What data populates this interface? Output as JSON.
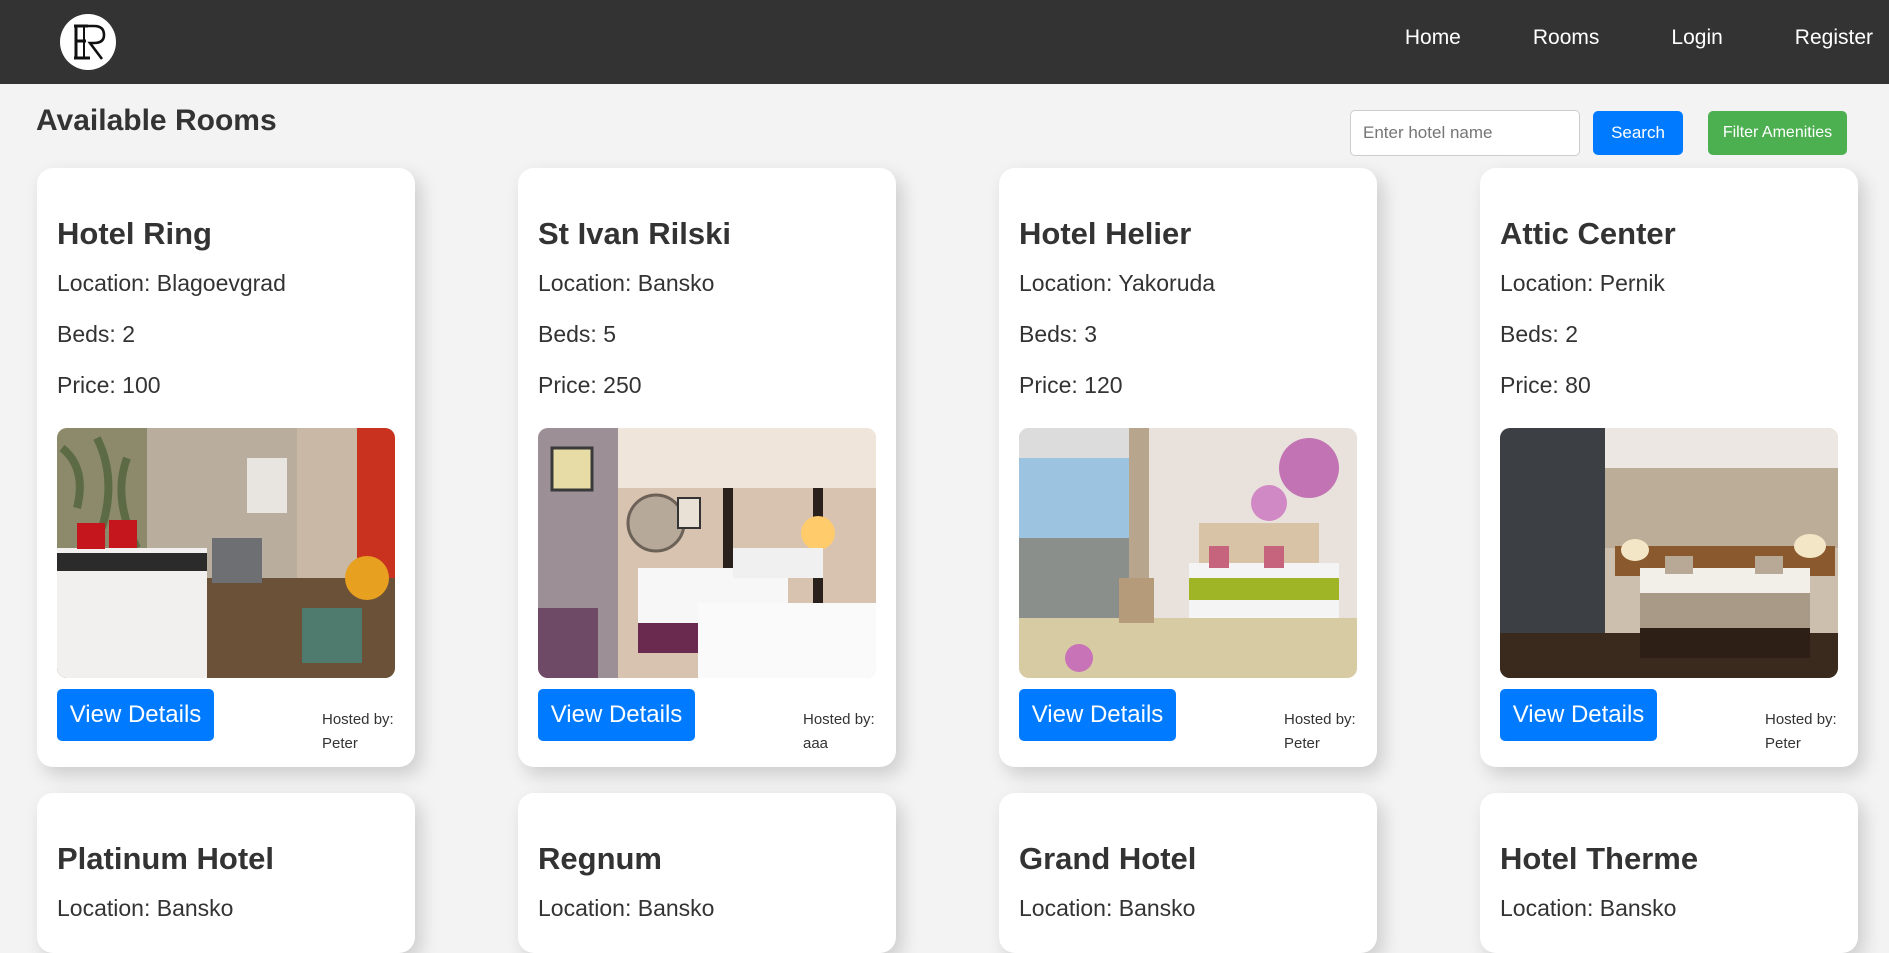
{
  "nav": {
    "logo_icon": "er-monogram-logo",
    "links": [
      "Home",
      "Rooms",
      "Login",
      "Register"
    ]
  },
  "page": {
    "title": "Available Rooms"
  },
  "search": {
    "placeholder": "Enter hotel name",
    "value": "",
    "button_label": "Search"
  },
  "filter": {
    "button_label": "Filter Amenities"
  },
  "colors": {
    "navbar": "#333333",
    "primary_button": "#007bff",
    "filter_button": "#4caf50",
    "background": "#f3f3f3"
  },
  "rooms": [
    {
      "name": "Hotel Ring",
      "location": "Location: Blagoevgrad",
      "beds": "Beds: 2",
      "price": "Price: 100",
      "details_label": "View Details",
      "hosted_by_label": "Hosted by:",
      "host": "Peter",
      "image": "hotel-room-photo"
    },
    {
      "name": "St Ivan Rilski",
      "location": "Location: Bansko",
      "beds": "Beds: 5",
      "price": "Price: 250",
      "details_label": "View Details",
      "hosted_by_label": "Hosted by:",
      "host": "aaa",
      "image": "hotel-room-photo"
    },
    {
      "name": "Hotel Helier",
      "location": "Location: Yakoruda",
      "beds": "Beds: 3",
      "price": "Price: 120",
      "details_label": "View Details",
      "hosted_by_label": "Hosted by:",
      "host": "Peter",
      "image": "hotel-room-photo"
    },
    {
      "name": "Attic Center",
      "location": "Location: Pernik",
      "beds": "Beds: 2",
      "price": "Price: 80",
      "details_label": "View Details",
      "hosted_by_label": "Hosted by:",
      "host": "Peter",
      "image": "hotel-room-photo"
    },
    {
      "name": "Platinum Hotel",
      "location": "Location: Bansko"
    },
    {
      "name": "Regnum",
      "location": "Location: Bansko"
    },
    {
      "name": "Grand Hotel",
      "location": "Location: Bansko"
    },
    {
      "name": "Hotel Therme",
      "location": "Location: Bansko"
    }
  ]
}
